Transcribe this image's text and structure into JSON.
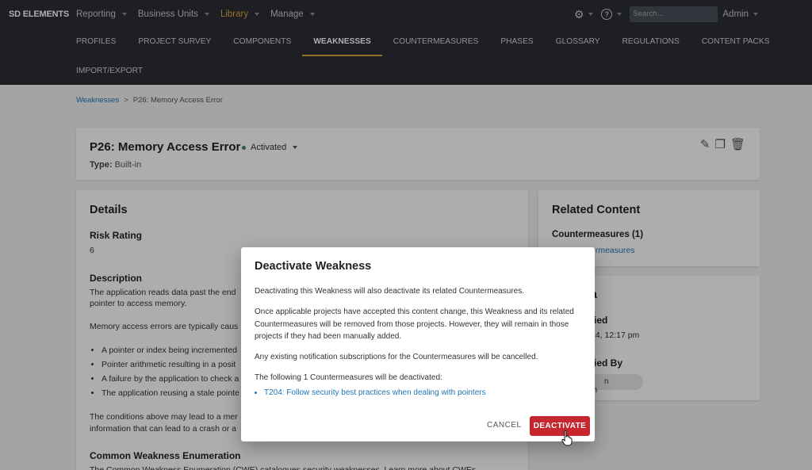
{
  "nav": {
    "logo": "SD ELEMENTS",
    "menu": [
      "Reporting",
      "Business Units",
      "Library",
      "Manage"
    ],
    "search_placeholder": "Search...",
    "user": "Admin"
  },
  "tabs": [
    "PROFILES",
    "PROJECT SURVEY",
    "COMPONENTS",
    "WEAKNESSES",
    "COUNTERMEASURES",
    "PHASES",
    "GLOSSARY",
    "REGULATIONS",
    "CONTENT PACKS"
  ],
  "tab_second_row": "IMPORT/EXPORT",
  "breadcrumb": {
    "parent": "Weaknesses",
    "sep": ">",
    "current": "P26: Memory Access Error"
  },
  "header": {
    "title": "P26: Memory Access Error",
    "status": "Activated",
    "type_label": "Type:",
    "type_value": "Built-in"
  },
  "details": {
    "title": "Details",
    "risk_label": "Risk Rating",
    "risk_value": "6",
    "desc_label": "Description",
    "desc_line1": "The application reads data past the end",
    "desc_line2": "pointer to access memory.",
    "desc_line3": "Memory access errors are typically caus",
    "bullets": [
      "A pointer or index being incremented",
      "Pointer arithmetic resulting in a posit",
      "A failure by the application to check a",
      "The application reusing a stale pointe"
    ],
    "cond_line1": "The conditions above may lead to a mer",
    "cond_line2": "information that can lead to a crash or a",
    "cwe_label": "Common Weakness Enumeration",
    "cwe_text": "The Common Weakness Enumeration (CWE) catalogues security weaknesses. Learn more about CWEs"
  },
  "related": {
    "title": "Related Content",
    "cm_label": "Countermeasures (1)",
    "cm_link": "ermeasures"
  },
  "meta": {
    "title": "ta",
    "modified_label": "fied",
    "modified_value": "24, 12:17 pm",
    "by_label": "fied By",
    "by_value": "n Testerton"
  },
  "modal": {
    "title": "Deactivate Weakness",
    "p1": "Deactivating this Weakness will also deactivate its related Countermeasures.",
    "p2": "Once applicable projects have accepted this content change, this Weakness and its related Countermeasures will be removed from those projects. However, they will remain in those projects if they had been manually added.",
    "p3": "Any existing notification subscriptions for the Countermeasures will be cancelled.",
    "p4": "The following 1 Countermeasures will be deactivated:",
    "item": "T204: Follow security best practices when dealing with pointers",
    "cancel": "CANCEL",
    "confirm": "DEACTIVATE"
  }
}
